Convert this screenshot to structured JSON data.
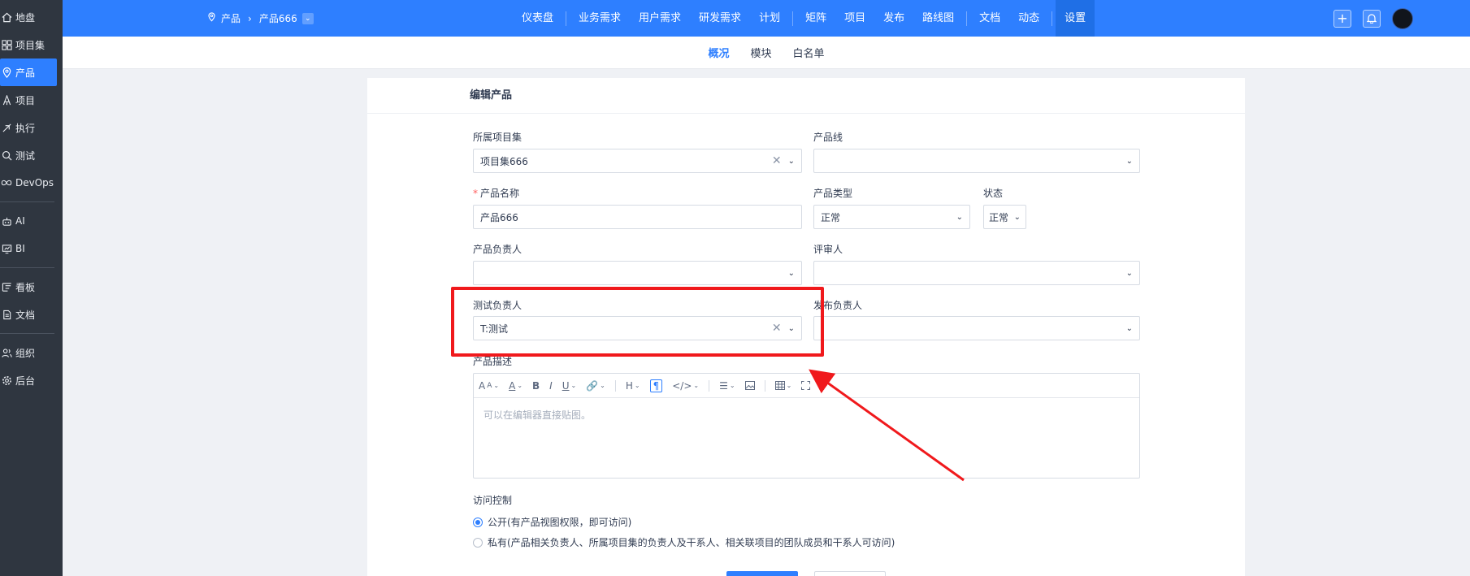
{
  "sidebar": {
    "items": [
      {
        "label": "地盘",
        "icon": "home-icon"
      },
      {
        "label": "项目集",
        "icon": "grid-icon"
      },
      {
        "label": "产品",
        "icon": "location-pin-icon",
        "active": true
      },
      {
        "label": "项目",
        "icon": "rocket-icon"
      },
      {
        "label": "执行",
        "icon": "run-icon"
      },
      {
        "label": "测试",
        "icon": "magnifier-icon"
      },
      {
        "label": "DevOps",
        "icon": "infinity-icon"
      },
      {
        "label": "AI",
        "icon": "robot-icon"
      },
      {
        "label": "BI",
        "icon": "chart-board-icon"
      },
      {
        "label": "看板",
        "icon": "kanban-icon"
      },
      {
        "label": "文档",
        "icon": "document-icon"
      },
      {
        "label": "组织",
        "icon": "people-icon"
      },
      {
        "label": "后台",
        "icon": "gear-icon"
      }
    ]
  },
  "header": {
    "breadcrumb": {
      "root": "产品",
      "current": "产品666"
    },
    "nav": [
      "仪表盘",
      "业务需求",
      "用户需求",
      "研发需求",
      "计划",
      "矩阵",
      "项目",
      "发布",
      "路线图",
      "文档",
      "动态",
      "设置"
    ],
    "active_nav": "设置"
  },
  "subnav": {
    "tabs": [
      "概况",
      "模块",
      "白名单"
    ],
    "active": "概况"
  },
  "form": {
    "title": "编辑产品",
    "program": {
      "label": "所属项目集",
      "value": "项目集666"
    },
    "line": {
      "label": "产品线",
      "value": ""
    },
    "name": {
      "label": "产品名称",
      "value": "产品666",
      "required_mark": "*"
    },
    "type": {
      "label": "产品类型",
      "value": "正常"
    },
    "status": {
      "label": "状态",
      "value": "正常"
    },
    "po": {
      "label": "产品负责人",
      "value": ""
    },
    "reviewer": {
      "label": "评审人",
      "value": ""
    },
    "qd": {
      "label": "测试负责人",
      "value": "T:测试"
    },
    "rd": {
      "label": "发布负责人",
      "value": ""
    },
    "desc": {
      "label": "产品描述",
      "placeholder": "可以在编辑器直接贴图。"
    },
    "acl": {
      "label": "访问控制",
      "options": [
        {
          "text": "公开(有产品视图权限，即可访问)",
          "checked": true
        },
        {
          "text": "私有(产品相关负责人、所属项目集的负责人及干系人、相关联项目的团队成员和干系人可访问)",
          "checked": false
        }
      ]
    }
  },
  "colors": {
    "accent": "#2e7fff",
    "sidebar": "#2f3640",
    "annotation": "#f0191c"
  }
}
